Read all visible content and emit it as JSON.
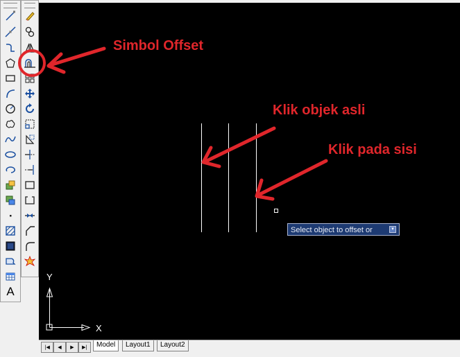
{
  "draw_toolbar": {
    "tools": [
      {
        "icon": "line-icon"
      },
      {
        "icon": "construction-line-icon"
      },
      {
        "icon": "polyline-icon"
      },
      {
        "icon": "polygon-icon"
      },
      {
        "icon": "rectangle-icon"
      },
      {
        "icon": "arc-icon"
      },
      {
        "icon": "circle-icon"
      },
      {
        "icon": "revision-cloud-icon"
      },
      {
        "icon": "spline-icon"
      },
      {
        "icon": "ellipse-icon"
      },
      {
        "icon": "ellipse-arc-icon"
      },
      {
        "icon": "insert-block-icon"
      },
      {
        "icon": "make-block-icon"
      },
      {
        "icon": "point-icon"
      },
      {
        "icon": "hatch-icon"
      },
      {
        "icon": "gradient-icon"
      },
      {
        "icon": "region-icon"
      },
      {
        "icon": "table-icon"
      },
      {
        "icon": "multiline-text-icon",
        "label": "A"
      }
    ]
  },
  "modify_toolbar": {
    "tools": [
      {
        "icon": "erase-icon"
      },
      {
        "icon": "copy-icon"
      },
      {
        "icon": "mirror-icon"
      },
      {
        "icon": "offset-icon"
      },
      {
        "icon": "array-icon"
      },
      {
        "icon": "move-icon"
      },
      {
        "icon": "rotate-icon"
      },
      {
        "icon": "scale-icon"
      },
      {
        "icon": "stretch-icon"
      },
      {
        "icon": "trim-icon"
      },
      {
        "icon": "extend-icon"
      },
      {
        "icon": "break-at-point-icon"
      },
      {
        "icon": "break-icon"
      },
      {
        "icon": "join-icon"
      },
      {
        "icon": "chamfer-icon"
      },
      {
        "icon": "fillet-icon"
      },
      {
        "icon": "explode-icon"
      }
    ]
  },
  "canvas": {
    "background": "#000000",
    "ucs": {
      "x_label": "X",
      "y_label": "Y"
    },
    "tooltip": {
      "text": "Select object to offset or",
      "drop_glyph": "▾"
    }
  },
  "annotations": {
    "color": "#e0262b",
    "offset_label": "Simbol Offset",
    "original_label": "Klik objek asli",
    "side_label": "Klik pada sisi"
  },
  "layout_tabs": {
    "nav": [
      "|◀",
      "◀",
      "▶",
      "▶|"
    ],
    "tabs": [
      {
        "label": "Model",
        "active": true
      },
      {
        "label": "Layout1",
        "active": false
      },
      {
        "label": "Layout2",
        "active": false
      }
    ]
  }
}
